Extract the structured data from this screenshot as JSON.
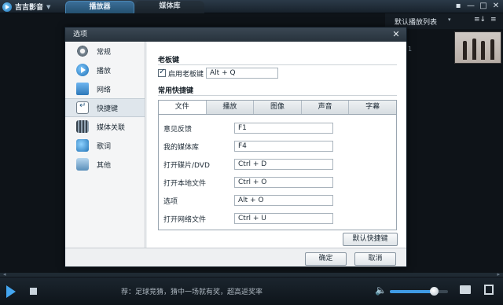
{
  "app": {
    "name": "吉吉影音",
    "tabs": [
      "播放器",
      "媒体库"
    ]
  },
  "window": {
    "buttons": [
      "▪",
      "—",
      "□",
      "✕"
    ]
  },
  "playlist": {
    "title": "默认播放列表",
    "caret": "▾",
    "icon1": "≡↓",
    "icon2": "≡",
    "side_number": "1"
  },
  "dialog": {
    "title": "选项",
    "close": "✕",
    "sidebar": [
      {
        "label": "常规",
        "icon": "gear-icon"
      },
      {
        "label": "播放",
        "icon": "play-icon"
      },
      {
        "label": "网络",
        "icon": "network-icon"
      },
      {
        "label": "快捷键",
        "icon": "keyboard-icon"
      },
      {
        "label": "媒体关联",
        "icon": "media-icon"
      },
      {
        "label": "歌词",
        "icon": "lyrics-icon"
      },
      {
        "label": "其他",
        "icon": "other-icon"
      }
    ],
    "active_sidebar_index": 3,
    "boss_key": {
      "heading": "老板键",
      "checkbox_label": "启用老板键",
      "checked": true,
      "value": "Alt + Q"
    },
    "shortcuts": {
      "heading": "常用快捷键",
      "tabs": [
        "文件",
        "播放",
        "图像",
        "声音",
        "字幕"
      ],
      "active_tab": 0,
      "rows": [
        {
          "label": "意见反馈",
          "value": "F1"
        },
        {
          "label": "我的媒体库",
          "value": "F4"
        },
        {
          "label": "打开碟片/DVD",
          "value": "Ctrl + D"
        },
        {
          "label": "打开本地文件",
          "value": "Ctrl + O"
        },
        {
          "label": "选项",
          "value": "Alt + O"
        },
        {
          "label": "打开网络文件",
          "value": "Ctrl + U"
        }
      ],
      "default_button": "默认快捷键"
    },
    "ok_button": "确定",
    "cancel_button": "取消"
  },
  "player": {
    "ticker": "荐：足球竞猜，猜中一场就有奖，超高返奖率",
    "volume_fraction": 0.77,
    "seek_left": "◂",
    "seek_right": "▸"
  },
  "colors": {
    "accent": "#3f9be4",
    "tab_active": "#2f5f86",
    "dialog_bg": "#eef0f2"
  }
}
